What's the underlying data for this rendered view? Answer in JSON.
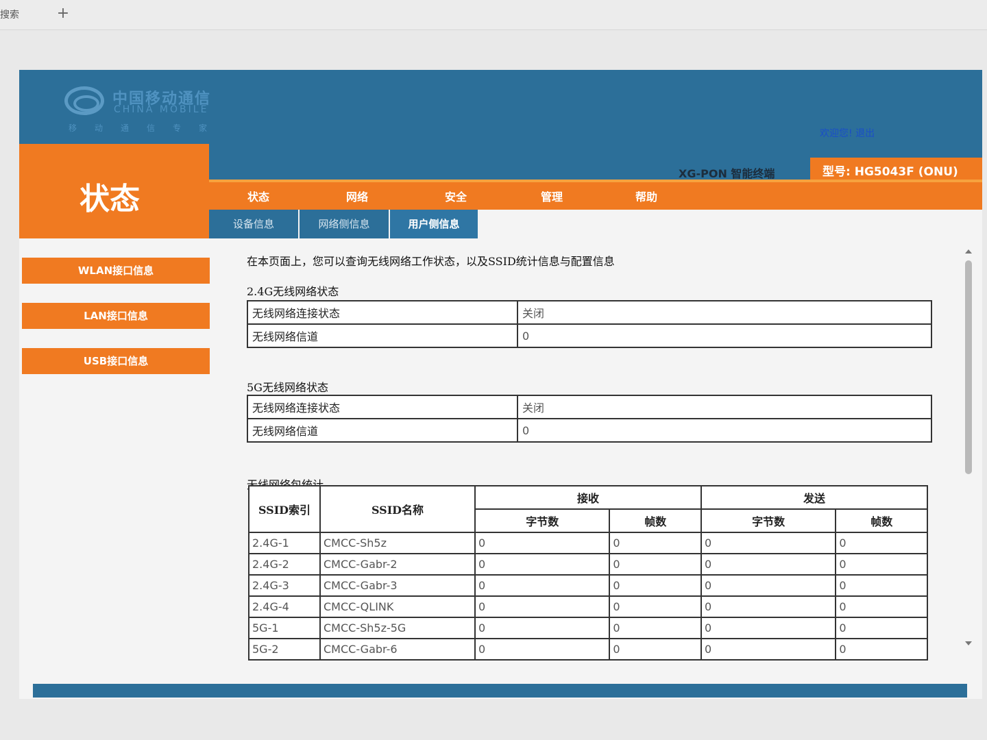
{
  "browser": {
    "tab_label": "搜索",
    "new_tab": "+"
  },
  "header": {
    "logo_cn": "中国移动通信",
    "logo_en": "CHINA MOBILE",
    "logo_sub": "移动通信专家",
    "welcome": "欢迎您!",
    "logout": "退出",
    "product": "XG-PON 智能终端",
    "model": "型号: HG5043F (ONU)"
  },
  "page_title": "状态",
  "menu": [
    "状态",
    "网络",
    "安全",
    "管理",
    "帮助"
  ],
  "subnav": [
    "设备信息",
    "网络侧信息",
    "用户侧信息"
  ],
  "sidebar": [
    "WLAN接口信息",
    "LAN接口信息",
    "USB接口信息"
  ],
  "content": {
    "intro": "在本页面上，您可以查询无线网络工作状态，以及SSID统计信息与配置信息",
    "wlan24": {
      "title": "2.4G无线网络状态",
      "rows": [
        {
          "k": "无线网络连接状态",
          "v": "关闭"
        },
        {
          "k": "无线网络信道",
          "v": "0"
        }
      ]
    },
    "wlan5": {
      "title": "5G无线网络状态",
      "rows": [
        {
          "k": "无线网络连接状态",
          "v": "关闭"
        },
        {
          "k": "无线网络信道",
          "v": "0"
        }
      ]
    },
    "stats": {
      "title": "无线网络包统计",
      "headers": {
        "ssid_index": "SSID索引",
        "ssid_name": "SSID名称",
        "recv": "接收",
        "send": "发送",
        "bytes": "字节数",
        "frames": "帧数"
      },
      "rows": [
        {
          "idx": "2.4G-1",
          "name": "CMCC-Sh5z",
          "rb": "0",
          "rf": "0",
          "sb": "0",
          "sf": "0"
        },
        {
          "idx": "2.4G-2",
          "name": "CMCC-Gabr-2",
          "rb": "0",
          "rf": "0",
          "sb": "0",
          "sf": "0"
        },
        {
          "idx": "2.4G-3",
          "name": "CMCC-Gabr-3",
          "rb": "0",
          "rf": "0",
          "sb": "0",
          "sf": "0"
        },
        {
          "idx": "2.4G-4",
          "name": "CMCC-QLINK",
          "rb": "0",
          "rf": "0",
          "sb": "0",
          "sf": "0"
        },
        {
          "idx": "5G-1",
          "name": "CMCC-Sh5z-5G",
          "rb": "0",
          "rf": "0",
          "sb": "0",
          "sf": "0"
        },
        {
          "idx": "5G-2",
          "name": "CMCC-Gabr-6",
          "rb": "0",
          "rf": "0",
          "sb": "0",
          "sf": "0"
        }
      ]
    }
  },
  "colors": {
    "brand_blue": "#2c6f99",
    "brand_orange": "#f07a21",
    "link_blue": "#1a4ec8"
  }
}
